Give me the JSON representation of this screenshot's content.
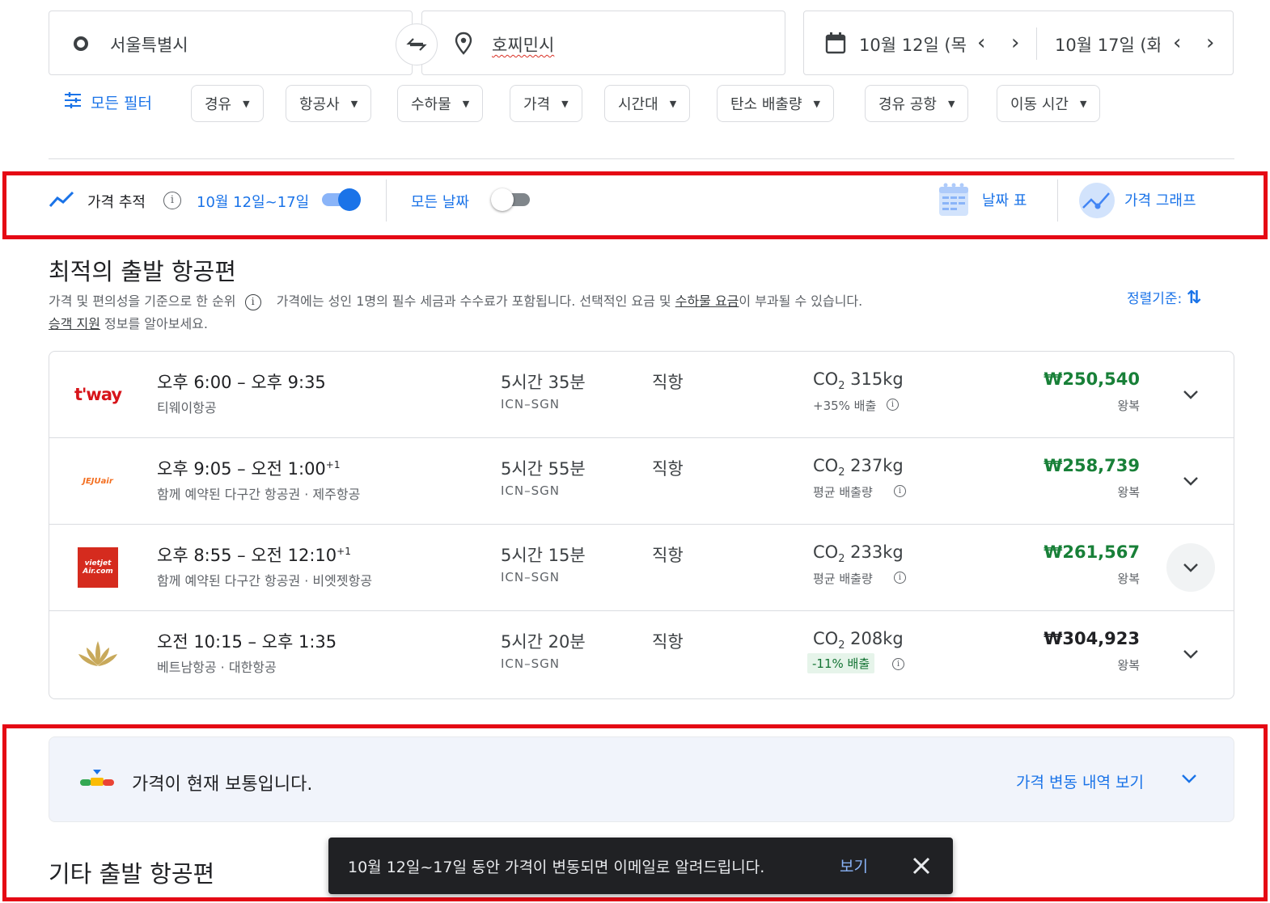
{
  "search": {
    "origin": "서울특별시",
    "destination": "호찌민시",
    "depart_date": "10월 12일 (목",
    "return_date": "10월 17일 (화"
  },
  "filters": {
    "all_filters": "모든 필터",
    "chips": [
      "경유",
      "항공사",
      "수하물",
      "가격",
      "시간대",
      "탄소 배출량",
      "경유 공항",
      "이동 시간"
    ]
  },
  "tracking": {
    "label": "가격 추적",
    "range": "10월 12일~17일",
    "all_dates": "모든 날짜",
    "date_grid": "날짜 표",
    "price_graph": "가격 그래프",
    "tracking_on": true,
    "all_dates_on": false
  },
  "best": {
    "title": "최적의 출발 항공편",
    "ranking_note": "가격 및 편의성을 기준으로 한 순위",
    "price_note_a": "가격에는 성인 1명의 필수 세금과 수수료가 포함됩니다. 선택적인 요금 및 ",
    "price_note_link": "수하물 요금",
    "price_note_b": "이 부과될 수 있습니다.",
    "support_link": "승객 지원",
    "support_rest": " 정보를 알아보세요.",
    "sort_label": "정렬기준:"
  },
  "flights": [
    {
      "logo": "t'way",
      "time": "오후 6:00 – 오후 9:35",
      "plus": "",
      "airline": "티웨이항공",
      "duration": "5시간 35분",
      "route": "ICN–SGN",
      "stops": "직항",
      "co2": "315kg",
      "emission": "+35% 배출",
      "emission_green": false,
      "price": "₩250,540",
      "price_color": "#188038",
      "trip": "왕복"
    },
    {
      "logo": "JEJUair",
      "time": "오후 9:05 – 오전 1:00",
      "plus": "+1",
      "airline": "함께 예약된 다구간 항공권 · 제주항공",
      "duration": "5시간 55분",
      "route": "ICN–SGN",
      "stops": "직항",
      "co2": "237kg",
      "emission": "평균 배출량",
      "emission_green": false,
      "price": "₩258,739",
      "price_color": "#188038",
      "trip": "왕복"
    },
    {
      "logo": "vietjet Air.com",
      "time": "오후 8:55 – 오전 12:10",
      "plus": "+1",
      "airline": "함께 예약된 다구간 항공권 · 비엣젯항공",
      "duration": "5시간 15분",
      "route": "ICN–SGN",
      "stops": "직항",
      "co2": "233kg",
      "emission": "평균 배출량",
      "emission_green": false,
      "price": "₩261,567",
      "price_color": "#188038",
      "trip": "왕복"
    },
    {
      "logo": "lotus",
      "time": "오전 10:15 – 오후 1:35",
      "plus": "",
      "airline": "베트남항공 · 대한항공",
      "duration": "5시간 20분",
      "route": "ICN–SGN",
      "stops": "직항",
      "co2": "208kg",
      "emission": "-11% 배출",
      "emission_green": true,
      "price": "₩304,923",
      "price_color": "#202124",
      "trip": "왕복"
    }
  ],
  "co2_label": "CO",
  "co2_sub": "2",
  "insight": {
    "text": "가격이 현재 보통입니다.",
    "history_link": "가격 변동 내역 보기"
  },
  "other": {
    "title": "기타 출발 항공편"
  },
  "snackbar": {
    "message": "10월 12일~17일 동안 가격이 변동되면 이메일로 알려드립니다.",
    "action": "보기"
  },
  "colors": {
    "accent": "#1a73e8",
    "highlight": "#e50914"
  }
}
